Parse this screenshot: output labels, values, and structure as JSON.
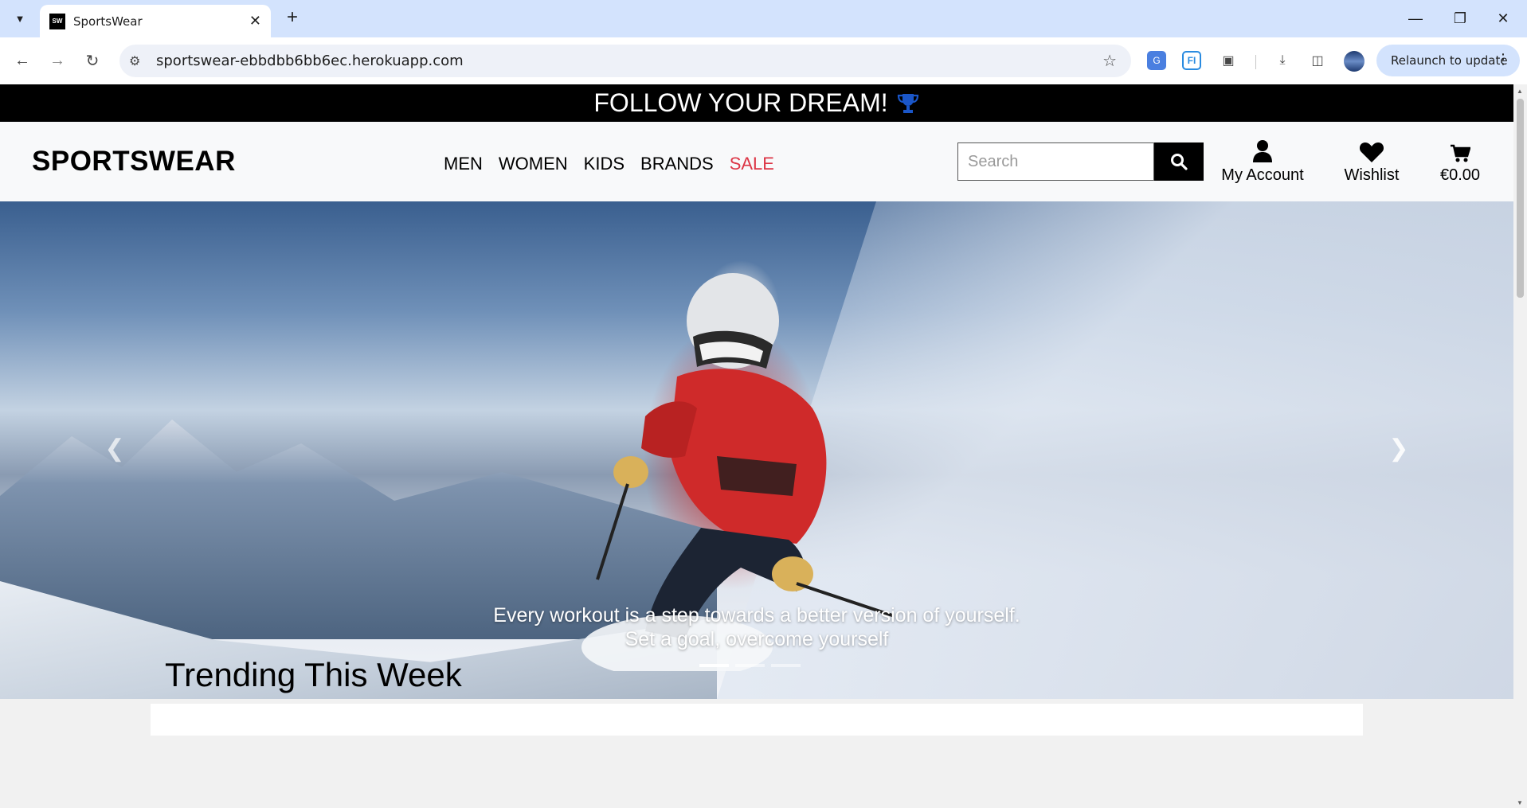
{
  "browser": {
    "tab_title": "SportsWear",
    "favicon_text": "SW",
    "url": "sportswear-ebbdbb6bb6ec.herokuapp.com",
    "relaunch_label": "Relaunch to update"
  },
  "promo": {
    "text": "FOLLOW YOUR DREAM!",
    "icon": "trophy-icon",
    "icon_color": "#1a56c8"
  },
  "header": {
    "logo": "SPORTSWEAR",
    "nav": [
      "MEN",
      "WOMEN",
      "KIDS",
      "BRANDS",
      "SALE"
    ],
    "sale_color": "#dc3545",
    "search_placeholder": "Search",
    "account_label": "My Account",
    "wishlist_label": "Wishlist",
    "cart_total": "€0.00"
  },
  "hero": {
    "caption_line1": "Every workout is a step towards a better version of yourself.",
    "caption_line2": "Set a goal, overcome yourself",
    "slide_count": 3,
    "active_slide": 1
  },
  "section": {
    "title": "Trending This Week"
  }
}
